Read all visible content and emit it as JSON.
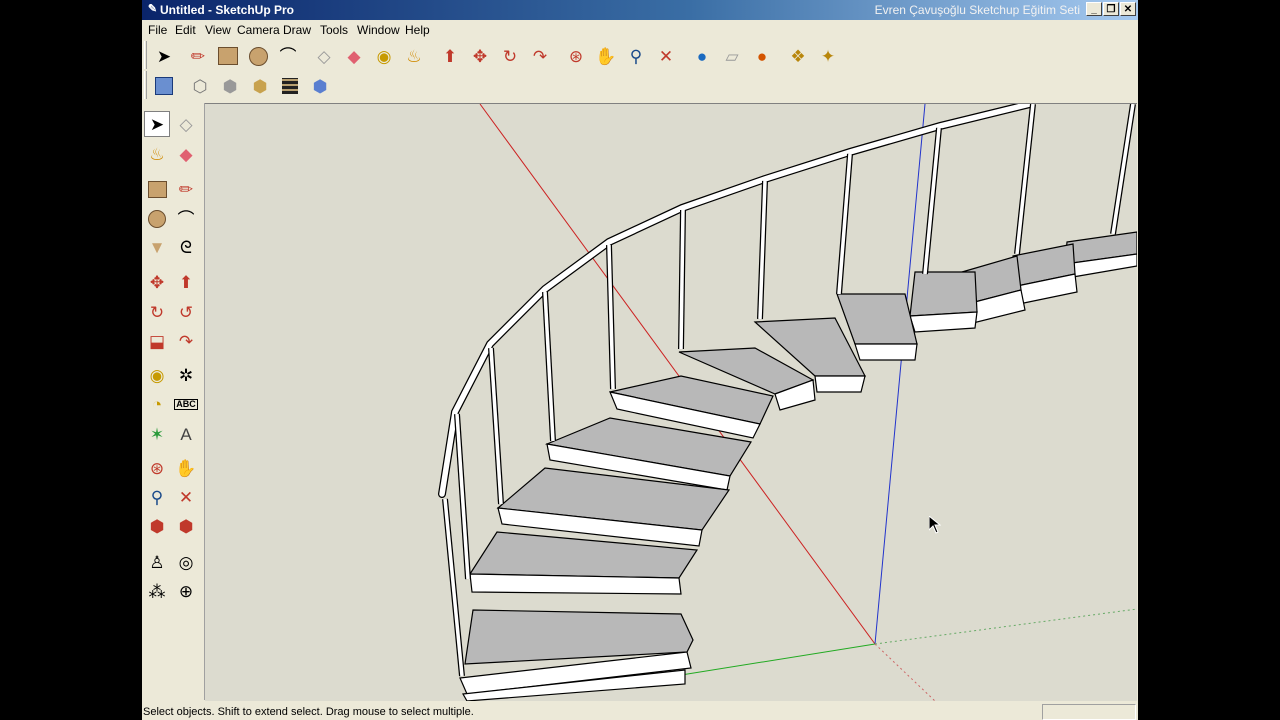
{
  "window": {
    "title": "Untitled - SketchUp Pro",
    "overlay_text": "Evren Çavuşoğlu Sketchup Eğitim Seti",
    "controls": {
      "minimize": "_",
      "maximize": "❐",
      "close": "✕"
    }
  },
  "menu": {
    "items": [
      "File",
      "Edit",
      "View",
      "Camera",
      "Draw",
      "Tools",
      "Window",
      "Help"
    ]
  },
  "toolbar_top": {
    "row1_icons": [
      "select-icon",
      "pencil-icon",
      "rectangle-icon",
      "circle-icon",
      "arc-icon",
      "eraser-icon",
      "paint-eraser-icon",
      "tape-measure-icon",
      "paint-bucket-icon",
      "push-pull-icon",
      "move-icon",
      "rotate-icon",
      "follow-me-icon",
      "orbit-icon",
      "pan-icon",
      "zoom-icon",
      "zoom-extents-icon",
      "google-earth-icon",
      "get-models-icon",
      "share-model-icon",
      "components-icon",
      "warehouse-icon"
    ],
    "row2_icons": [
      "iso-view-icon",
      "wireframe-icon",
      "hidden-line-icon",
      "shaded-icon",
      "textured-icon",
      "xray-icon"
    ]
  },
  "toolbar_left": {
    "icons": [
      "select-icon",
      "make-component-icon",
      "paint-bucket-icon",
      "eraser-icon",
      "rectangle-icon",
      "line-icon",
      "circle-icon",
      "arc-icon",
      "polygon-icon",
      "freehand-icon",
      "move-icon",
      "push-pull-icon",
      "rotate-icon",
      "follow-me-icon",
      "scale-icon",
      "offset-icon",
      "tape-measure-icon",
      "dimension-icon",
      "protractor-icon",
      "text-icon",
      "axes-icon",
      "3d-text-icon",
      "orbit-icon",
      "pan-icon",
      "zoom-icon",
      "zoom-window-icon",
      "previous-view-icon",
      "next-view-icon",
      "position-camera-icon",
      "look-around-icon",
      "walk-icon",
      "section-plane-icon"
    ]
  },
  "statusbar": {
    "text": "Select objects. Shift to extend select. Drag mouse to select multiple."
  },
  "colors": {
    "title_start": "#0a246a",
    "title_end": "#a6caf0",
    "chrome": "#ece9d8",
    "viewport_bg": "#dcdbcf",
    "axis_red": "#cc2222",
    "axis_green": "#22aa22",
    "axis_blue": "#2233cc",
    "tread_top": "#b8b8b8",
    "riser": "#ffffff"
  }
}
